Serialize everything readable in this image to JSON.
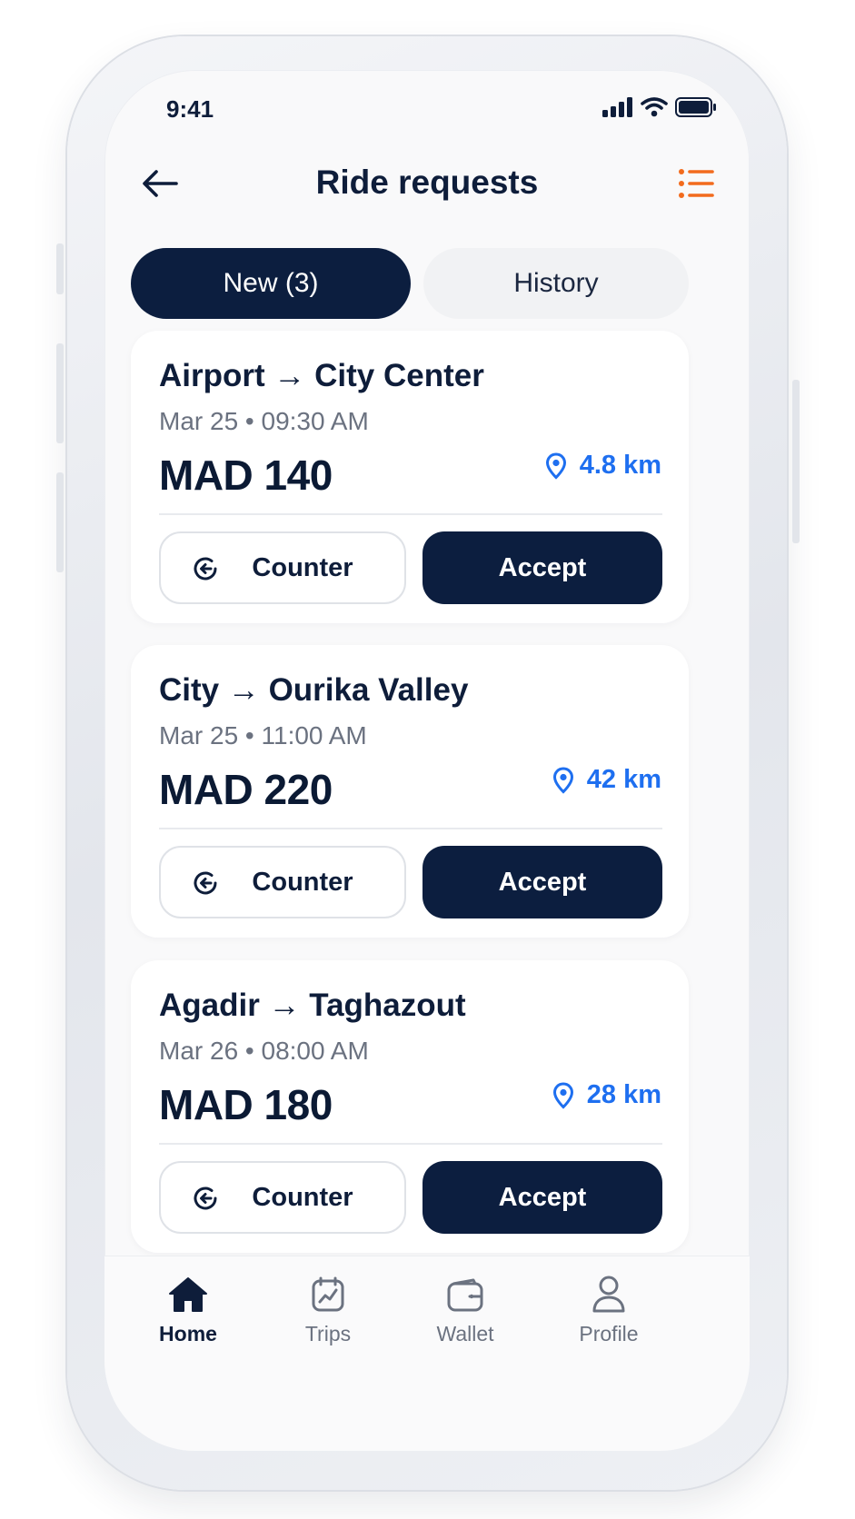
{
  "status_bar": {
    "time": "9:41"
  },
  "header": {
    "title": "Ride requests",
    "accent_color": "#f26b1d"
  },
  "tabs": [
    {
      "label": "New (3)",
      "active": true
    },
    {
      "label": "History",
      "active": false
    }
  ],
  "requests": [
    {
      "route": "Airport → City Center",
      "datetime": "Mar 25 • 09:30 AM",
      "price": "MAD 140",
      "distance": "4.8 km",
      "counter_label": "Counter",
      "accept_label": "Accept"
    },
    {
      "route": "City → Ourika Valley",
      "datetime": "Mar 25 • 11:00 AM",
      "price": "MAD 220",
      "distance": "42 km",
      "counter_label": "Counter",
      "accept_label": "Accept"
    },
    {
      "route": "Agadir → Taghazout",
      "datetime": "Mar 26 • 08:00 AM",
      "price": "MAD 180",
      "distance": "28 km",
      "counter_label": "Counter",
      "accept_label": "Accept"
    }
  ],
  "bottom_nav": [
    {
      "label": "Home",
      "icon": "home-icon",
      "active": true
    },
    {
      "label": "Trips",
      "icon": "trips-icon",
      "active": false
    },
    {
      "label": "Wallet",
      "icon": "wallet-icon",
      "active": false
    },
    {
      "label": "Profile",
      "icon": "profile-icon",
      "active": false
    }
  ],
  "colors": {
    "primary": "#0c1e3f",
    "distance_blue": "#1e6ff0",
    "muted_text": "#6b7280"
  }
}
